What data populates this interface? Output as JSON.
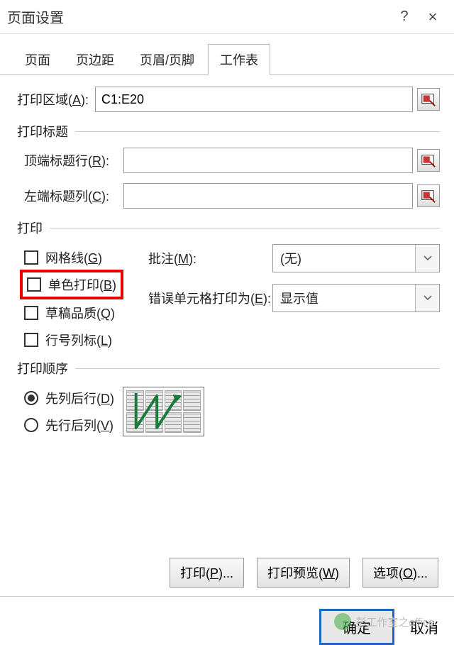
{
  "window": {
    "title": "页面设置",
    "help_symbol": "?",
    "close_symbol": "×"
  },
  "tabs": {
    "page": "页面",
    "margins": "页边距",
    "header_footer": "页眉/页脚",
    "sheet": "工作表"
  },
  "print_area": {
    "label_prefix": "打印区域(",
    "label_hotkey": "A",
    "label_suffix": "):",
    "value": "C1:E20"
  },
  "titles_group": "打印标题",
  "top_row": {
    "label_prefix": "顶端标题行(",
    "label_hotkey": "R",
    "label_suffix": "):",
    "value": ""
  },
  "left_col": {
    "label_prefix": "左端标题列(",
    "label_hotkey": "C",
    "label_suffix": "):",
    "value": ""
  },
  "print_group": "打印",
  "checks": {
    "gridlines_prefix": "网格线(",
    "gridlines_hotkey": "G",
    "gridlines_suffix": ")",
    "mono_prefix": "单色打印(",
    "mono_hotkey": "B",
    "mono_suffix": ")",
    "draft_prefix": "草稿品质(",
    "draft_hotkey": "Q",
    "draft_suffix": ")",
    "rowcol_prefix": "行号列标(",
    "rowcol_hotkey": "L",
    "rowcol_suffix": ")"
  },
  "comments": {
    "label_prefix": "批注(",
    "label_hotkey": "M",
    "label_suffix": "):",
    "value": "(无)"
  },
  "errors": {
    "label_prefix": "错误单元格打印为(",
    "label_hotkey": "E",
    "label_suffix": "):",
    "value": "显示值"
  },
  "order_group": "打印顺序",
  "order": {
    "down_prefix": "先列后行(",
    "down_hotkey": "D",
    "down_suffix": ")",
    "over_prefix": "先行后列(",
    "over_hotkey": "V",
    "over_suffix": ")"
  },
  "buttons": {
    "print_prefix": "打印(",
    "print_hotkey": "P",
    "print_suffix": ")...",
    "preview_prefix": "打印预览(",
    "preview_hotkey": "W",
    "preview_suffix": ")",
    "options_prefix": "选项(",
    "options_hotkey": "O",
    "options_suffix": ")...",
    "ok": "确定",
    "cancel": "取消"
  },
  "watermark": "彭工作室之office"
}
